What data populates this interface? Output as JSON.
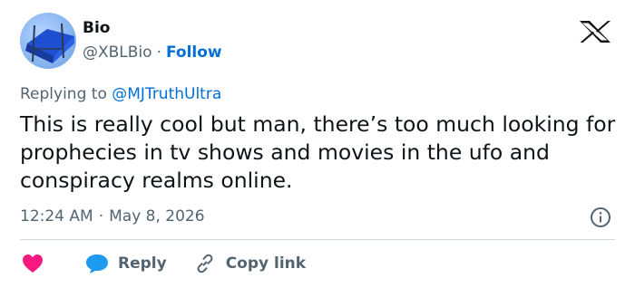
{
  "colors": {
    "accent_blue": "#006fd6",
    "text_primary": "#0f1419",
    "text_secondary": "#536471",
    "heart_red": "#f91880",
    "reply_blue": "#1d9bf0",
    "divider": "#cfd9de"
  },
  "author": {
    "name": "Bio",
    "handle": "@XBLBio",
    "separator": "·",
    "follow_label": "Follow"
  },
  "platform_logo": "x-logo-icon",
  "reply_context": {
    "prefix": "Replying to",
    "mention": "@MJTruthUltra"
  },
  "tweet": {
    "text": "This is really cool but man, there’s too much looking for prophecies in tv shows and movies in the ufo and conspiracy realms online.",
    "time": "12:24 AM",
    "separator": "·",
    "date": "May 8, 2026"
  },
  "icons": {
    "info": "info-icon",
    "heart": "heart-icon",
    "reply": "speech-bubble-icon",
    "copy": "link-icon"
  },
  "actions": {
    "reply_label": "Reply",
    "copy_link_label": "Copy link"
  }
}
